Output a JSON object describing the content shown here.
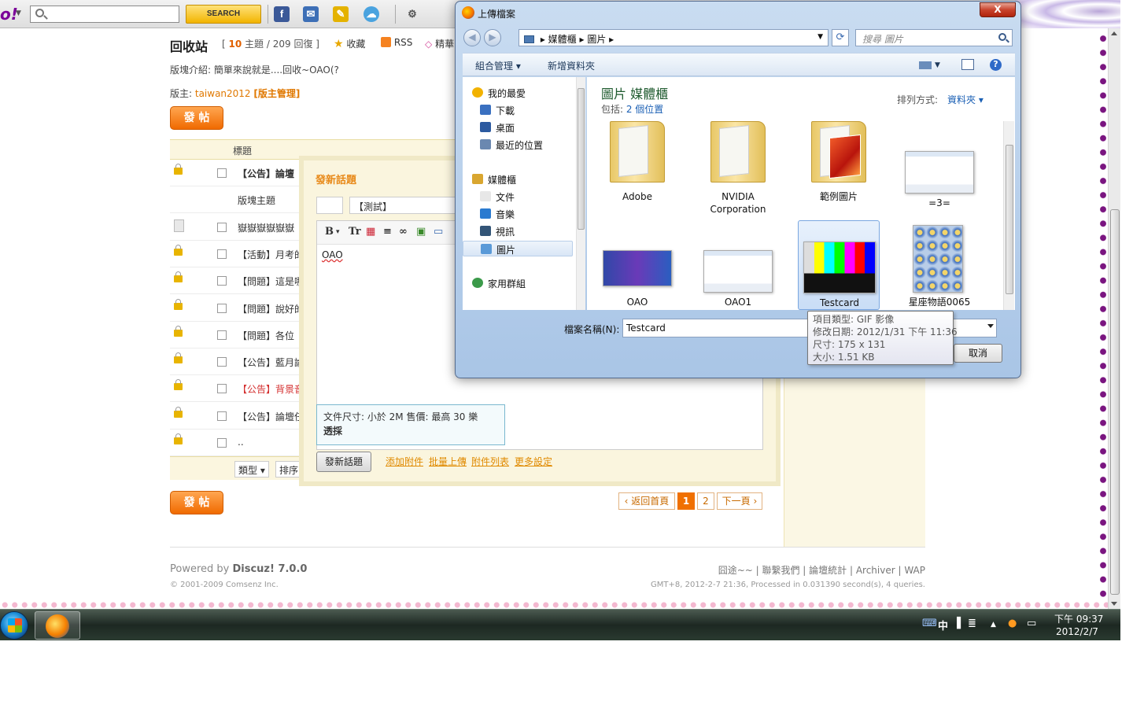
{
  "browser_toolbar": {
    "logo": "o!",
    "search_button": "SEARCH",
    "search_value": ""
  },
  "forum": {
    "title": "回收站",
    "stats_prefix": "[",
    "topics_count": "10",
    "topics_label": "主題 / 209 回復 ]",
    "favorite": "收藏",
    "rss": "RSS",
    "digest": "精華",
    "description": "版塊介紹: 簡單來說就是....回收~OAO(?",
    "moderator_label": "版主: ",
    "moderator_user": "taiwan2012",
    "moderator_manage": "[版主管理]",
    "post_button": "發 帖",
    "column_title": "標題",
    "threads": [
      {
        "title": "【公告】論壇",
        "icon": "lock",
        "checkbox": true,
        "bold": true,
        "highlight": false
      },
      {
        "title": "版塊主題",
        "icon": "none",
        "checkbox": false,
        "bold": false,
        "highlight": false
      },
      {
        "title": "嶽嶽嶽嶽嶽嶽",
        "icon": "doc",
        "checkbox": true,
        "bold": false,
        "highlight": false
      },
      {
        "title": "【活動】月考的",
        "icon": "lock",
        "checkbox": true,
        "bold": false,
        "highlight": false
      },
      {
        "title": "【問題】這是哪",
        "icon": "lock",
        "checkbox": true,
        "bold": false,
        "highlight": false
      },
      {
        "title": "【問題】說好的",
        "icon": "lock",
        "checkbox": true,
        "bold": false,
        "highlight": false
      },
      {
        "title": "【問題】各位",
        "icon": "lock",
        "checkbox": true,
        "bold": false,
        "highlight": false
      },
      {
        "title": "【公告】藍月論",
        "icon": "lock",
        "checkbox": true,
        "bold": false,
        "highlight": false
      },
      {
        "title": "【公告】背景音",
        "icon": "lock",
        "checkbox": true,
        "bold": false,
        "highlight": true
      },
      {
        "title": "【公告】論壇任",
        "icon": "lock",
        "checkbox": true,
        "bold": false,
        "highlight": false
      },
      {
        "title": "..",
        "icon": "lock",
        "checkbox": true,
        "bold": false,
        "highlight": false
      }
    ],
    "filter_type": "類型",
    "filter_sort": "排序",
    "pager": {
      "back": "返回首頁",
      "pages": [
        "1",
        "2"
      ],
      "current": "1",
      "next": "下一頁"
    },
    "footer": {
      "powered_prefix": "Powered by ",
      "powered_brand": "Discuz! 7.0.0",
      "copyright": "© 2001-2009 Comsenz Inc.",
      "links": "囧途~~  |  聯繫我們  |  論壇統計  |  Archiver  |  WAP",
      "meta": "GMT+8, 2012-2-7 21:36, Processed in 0.031390 second(s), 4 queries."
    }
  },
  "new_topic": {
    "title": "發新話題",
    "subject": "【測試】",
    "body": "OAO",
    "tip_line1": "文件尺寸: 小於 2M   售價: 最高 30 樂",
    "tip_line2": "透採",
    "submit": "發新話題",
    "links": [
      "添加附件",
      "批量上傳",
      "附件列表",
      "更多設定"
    ]
  },
  "dialog": {
    "title": "上傳檔案",
    "close": "X",
    "address": [
      "媒體櫃",
      "圖片"
    ],
    "search_placeholder": "搜尋 圖片",
    "commands": {
      "organize": "組合管理 ▾",
      "new_folder": "新增資料夾"
    },
    "tree": [
      {
        "label": "我的最愛",
        "icon": "star",
        "selected": false
      },
      {
        "label": "下載",
        "icon": "download",
        "selected": false
      },
      {
        "label": "桌面",
        "icon": "desktop",
        "selected": false
      },
      {
        "label": "最近的位置",
        "icon": "recent",
        "selected": false
      },
      {
        "label": "媒體櫃",
        "icon": "library",
        "selected": false
      },
      {
        "label": "文件",
        "icon": "docs",
        "selected": false
      },
      {
        "label": "音樂",
        "icon": "music",
        "selected": false
      },
      {
        "label": "視訊",
        "icon": "video",
        "selected": false
      },
      {
        "label": "圖片",
        "icon": "pictures",
        "selected": true
      },
      {
        "label": "家用群組",
        "icon": "homegroup",
        "selected": false
      }
    ],
    "library_title": "圖片 媒體櫃",
    "library_includes": "包括: ",
    "library_locations": "2 個位置",
    "sort_label": "排列方式:",
    "sort_value": "資料夾 ▾",
    "files": [
      {
        "name": "Adobe",
        "kind": "folder",
        "selected": false
      },
      {
        "name": "NVIDIA Corporation",
        "kind": "folder",
        "selected": false
      },
      {
        "name": "範例圖片",
        "kind": "folder-photo",
        "selected": false
      },
      {
        "name": "=3=",
        "kind": "screenshot",
        "selected": false
      },
      {
        "name": "OAO",
        "kind": "image-blue",
        "selected": false
      },
      {
        "name": "OAO1",
        "kind": "screenshot",
        "selected": false
      },
      {
        "name": "Testcard",
        "kind": "testcard",
        "selected": true
      },
      {
        "name": "星座物語0065",
        "kind": "grid-image",
        "selected": false
      }
    ],
    "filename_label": "檔案名稱(N):",
    "filename_value": "Testcard",
    "cancel": "取消",
    "tooltip": {
      "type": "項目類型: GIF 影像",
      "modified": "修改日期: 2012/1/31 下午 11:36",
      "dimensions": "尺寸: 175 x 131",
      "size": "大小: 1.51 KB"
    }
  },
  "taskbar": {
    "tray": [
      "中",
      "▲"
    ],
    "time": "下午 09:37",
    "date": "2012/2/7"
  },
  "colors": {
    "accent_orange": "#f06a00",
    "link_orange": "#e08a00",
    "dialog_blue": "#a9c5e6",
    "dot_purple": "#7a1580",
    "dot_pink": "#f4b8d0"
  }
}
